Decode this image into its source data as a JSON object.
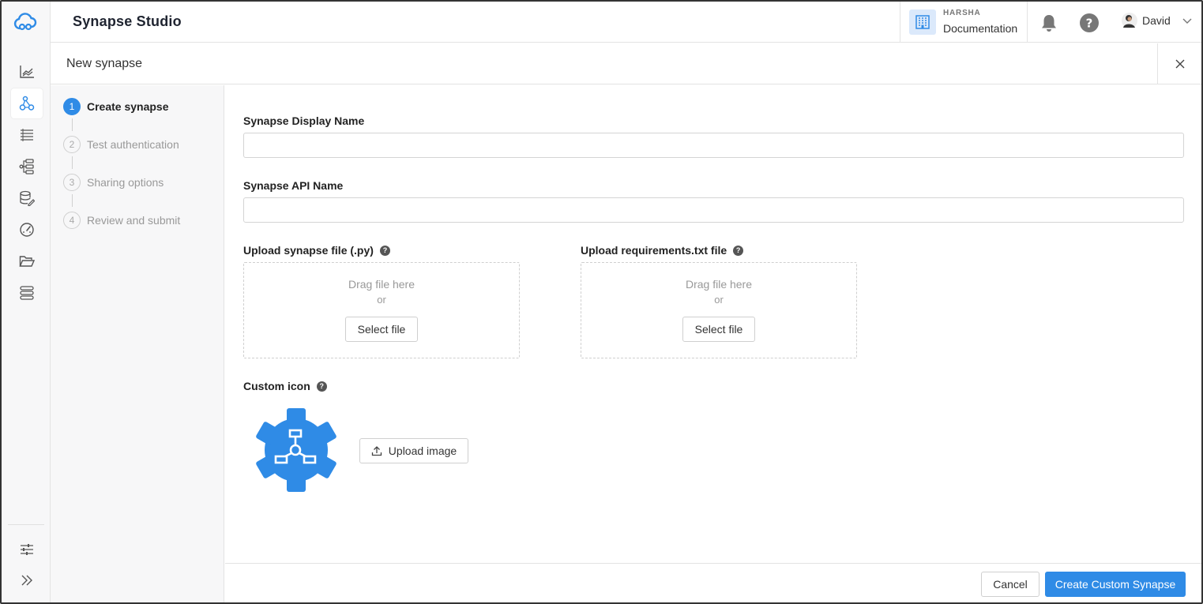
{
  "app": {
    "title": "Synapse Studio",
    "brand_color": "#2f8be6"
  },
  "rail": {
    "items": [
      {
        "icon": "analytics-chart-icon"
      },
      {
        "icon": "synapse-network-icon",
        "active": true
      },
      {
        "icon": "list-icon"
      },
      {
        "icon": "workflow-tree-icon"
      },
      {
        "icon": "database-edit-icon"
      },
      {
        "icon": "gauge-icon"
      },
      {
        "icon": "folder-open-icon"
      },
      {
        "icon": "server-stack-icon"
      }
    ],
    "bottom": [
      {
        "icon": "sliders-icon"
      },
      {
        "icon": "expand-double-chevron-icon"
      }
    ]
  },
  "header": {
    "org_name": "HARSHA",
    "org_link": "Documentation",
    "user_name": "David"
  },
  "dialog": {
    "title": "New synapse",
    "steps": [
      {
        "num": "1",
        "label": "Create synapse",
        "active": true
      },
      {
        "num": "2",
        "label": "Test authentication"
      },
      {
        "num": "3",
        "label": "Sharing options"
      },
      {
        "num": "4",
        "label": "Review and submit"
      }
    ],
    "form": {
      "display_name_label": "Synapse Display Name",
      "display_name_value": "",
      "api_name_label": "Synapse API Name",
      "api_name_value": "",
      "upload_py_label": "Upload synapse file (.py)",
      "upload_req_label": "Upload requirements.txt file",
      "drag_text": "Drag file here",
      "or_text": "or",
      "select_file": "Select file",
      "custom_icon_label": "Custom icon",
      "upload_image": "Upload image"
    },
    "footer": {
      "cancel": "Cancel",
      "submit": "Create Custom Synapse"
    }
  }
}
